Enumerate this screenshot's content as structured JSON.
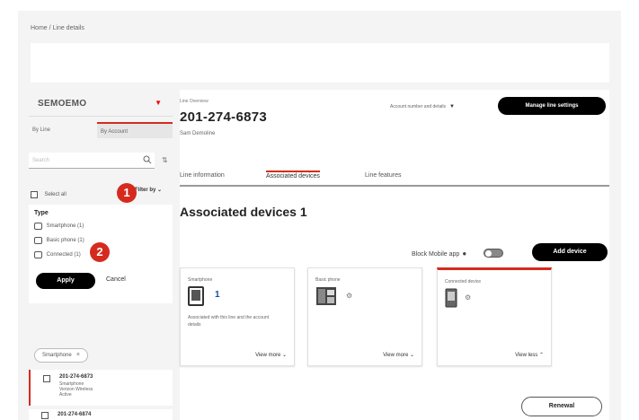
{
  "breadcrumb": "Home / Line details",
  "sidebar": {
    "account_name": "SEMOEMO",
    "tabs": [
      "By Line",
      "By Account"
    ],
    "search_placeholder": "Search",
    "select_all_label": "Select all",
    "filter_by_label": "Filter by",
    "filter": {
      "title": "Type",
      "options": [
        "Smartphone (1)",
        "Basic phone (1)",
        "Connected (1)"
      ],
      "apply_label": "Apply",
      "cancel_label": "Cancel"
    },
    "chip_label": "Smartphone",
    "results": [
      {
        "number": "201-274-6873",
        "line2": "Smartphone",
        "line3": "Verizon Wireless",
        "line4": "Active"
      },
      {
        "number": "201-274-6874",
        "line2": "",
        "line3": "",
        "line4": ""
      }
    ]
  },
  "markers": [
    "1",
    "2"
  ],
  "main": {
    "overview_label": "Line Overview",
    "phone_number": "201-274-6873",
    "owner": "Sam Demoline",
    "account_dropdown": "Account number and details",
    "manage_button": "Manage line settings",
    "tabs": [
      "Line information",
      "Associated devices",
      "Line features"
    ],
    "section_title": "Associated devices 1",
    "block_label": "Block Mobile app",
    "add_button": "Add device",
    "cards": [
      {
        "title": "Smartphone",
        "count": "1",
        "note1": "Associated with this line and the account",
        "note2": "details",
        "link": "View more"
      },
      {
        "title": "Basic phone",
        "link": "View more"
      },
      {
        "title": "Connected device",
        "link": "View less"
      }
    ],
    "renewal_button": "Renewal"
  },
  "colors": {
    "accent": "#d52b1e",
    "link": "#1a4fa3",
    "button": "#000000"
  }
}
